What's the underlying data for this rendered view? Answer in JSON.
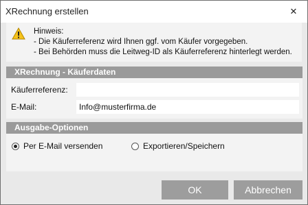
{
  "window": {
    "title": "XRechnung erstellen",
    "close_glyph": "✕"
  },
  "hint": {
    "icon": "warning-icon",
    "lines": [
      "Hinweis:",
      "- Die Käuferreferenz wird Ihnen ggf. vom Käufer vorgegeben.",
      "- Bei Behörden muss die Leitweg-ID als Käuferreferenz hinterlegt werden."
    ]
  },
  "buyer": {
    "header": "XRechnung - Käuferdaten",
    "reference_label": "Käuferreferenz:",
    "reference_value": "",
    "email_label": "E-Mail:",
    "email_value": "Info@musterfirma.de"
  },
  "output": {
    "header": "Ausgabe-Optionen",
    "option_email": "Per E-Mail versenden",
    "option_export": "Exportieren/Speichern",
    "selected": "email"
  },
  "buttons": {
    "ok": "OK",
    "cancel": "Abbrechen"
  },
  "colors": {
    "section_header": "#9a9a9a",
    "button": "#9d9d9d",
    "warning": "#f5c21b"
  }
}
